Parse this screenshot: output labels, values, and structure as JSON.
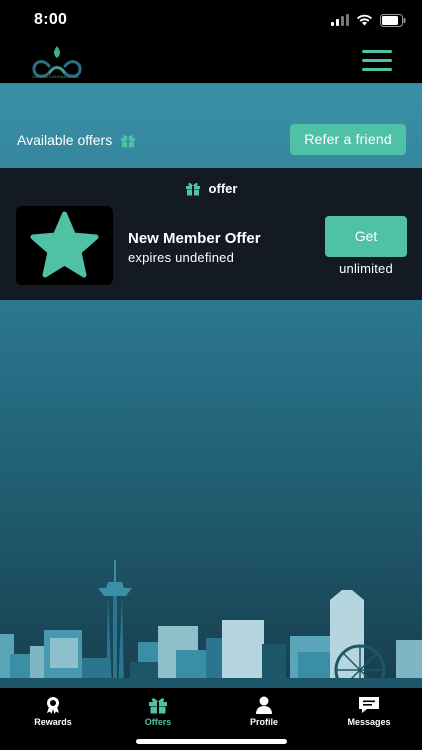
{
  "status_bar": {
    "time": "8:00"
  },
  "header": {
    "logo_text": "ZAPATA CANNABIS CO."
  },
  "offers_bar": {
    "label": "Available offers",
    "refer_label": "Refer a friend"
  },
  "offer_section": {
    "heading": "offer",
    "offer": {
      "title": "New Member Offer",
      "expires": "expires undefined",
      "action_label": "Get",
      "limit": "unlimited"
    }
  },
  "tabs": [
    {
      "label": "Rewards",
      "icon": "ribbon-icon",
      "active": false
    },
    {
      "label": "Offers",
      "icon": "gift-icon",
      "active": true
    },
    {
      "label": "Profile",
      "icon": "user-icon",
      "active": false
    },
    {
      "label": "Messages",
      "icon": "chat-icon",
      "active": false
    }
  ],
  "colors": {
    "accent": "#4fc1a5",
    "panel": "#141a24",
    "background_top": "#3a8fa6",
    "background_bottom": "#173f4e"
  }
}
